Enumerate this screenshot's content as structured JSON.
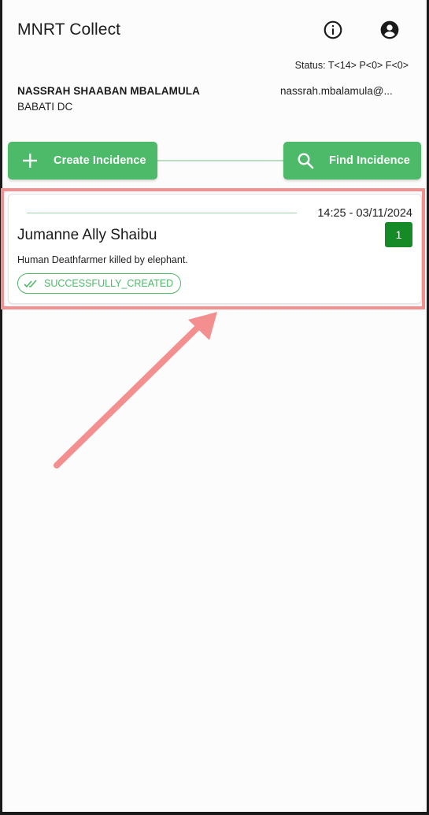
{
  "app": {
    "title": "MNRT Collect"
  },
  "header": {
    "info_icon": "info-icon",
    "account_icon": "account-circle-icon"
  },
  "status": {
    "text": "Status: T<14> P<0> F<0>"
  },
  "user": {
    "name": "NASSRAH SHAABAN MBALAMULA",
    "office": "BABATI DC",
    "email": "nassrah.mbalamula@..."
  },
  "actions": {
    "create_label": "Create Incidence",
    "create_icon": "plus-icon",
    "find_label": "Find Incidence",
    "find_icon": "search-icon"
  },
  "incidents": [
    {
      "datetime": "14:25 - 03/11/2024",
      "name": "Jumanne Ally Shaibu",
      "count": "1",
      "description": "Human Deathfarmer  killed by elephant.",
      "status": "SUCCESSFULLY_CREATED",
      "status_icon": "double-check-icon"
    }
  ],
  "colors": {
    "primary_green": "#4cba68",
    "badge_green": "#168a26",
    "highlight": "#f48f90"
  }
}
